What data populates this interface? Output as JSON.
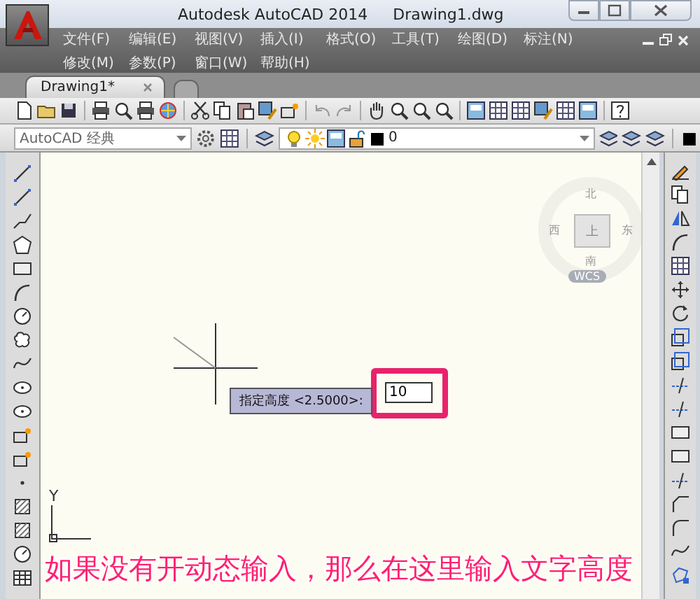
{
  "window": {
    "app_title": "Autodesk AutoCAD 2014",
    "file_name": "Drawing1.dwg"
  },
  "menu_rows": [
    [
      "文件(F)",
      "编辑(E)",
      "视图(V)",
      "插入(I)",
      "格式(O)",
      "工具(T)",
      "绘图(D)",
      "标注(N)"
    ],
    [
      "修改(M)",
      "参数(P)",
      "窗口(W)",
      "帮助(H)"
    ]
  ],
  "tabs": [
    {
      "label": "Drawing1*",
      "selected": true
    }
  ],
  "workspace": {
    "value": "AutoCAD 经典"
  },
  "layer": {
    "value": "0"
  },
  "viewcube": {
    "north": "北",
    "south": "南",
    "east": "东",
    "west": "西",
    "top": "上",
    "coordinate_system": "WCS"
  },
  "command_prompt": {
    "label": "指定高度 <2.5000>:",
    "value": "10"
  },
  "ucs": {
    "y_label": "Y"
  },
  "caption": "如果没有开动态输入，那么在这里输入文字高度"
}
